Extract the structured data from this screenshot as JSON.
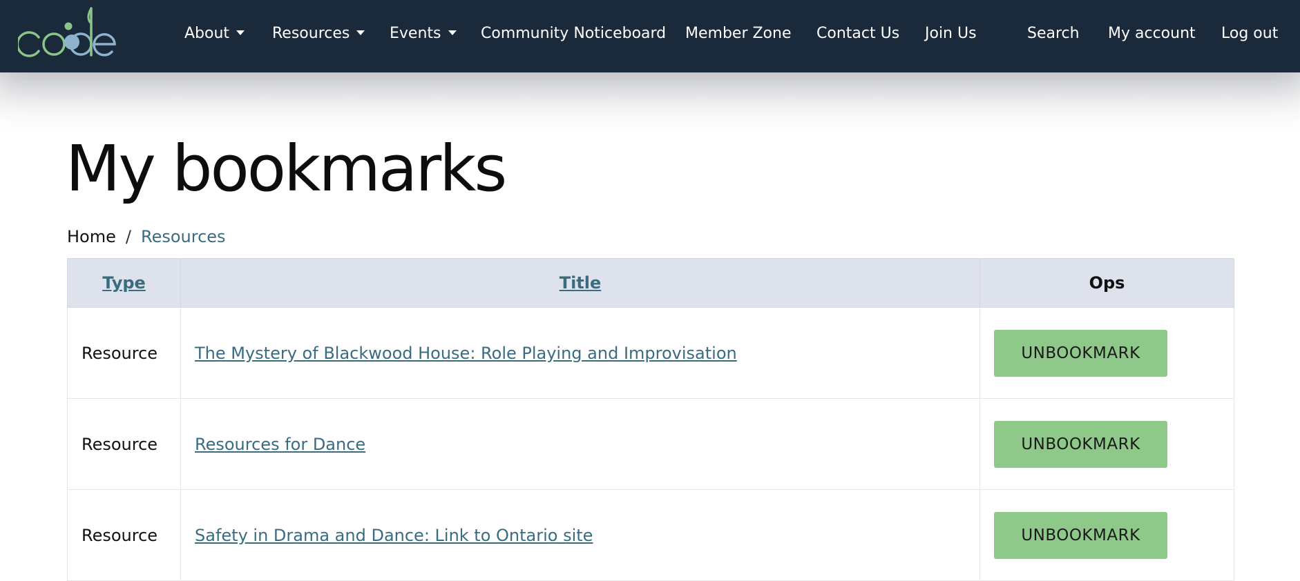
{
  "header": {
    "logo_text": "code",
    "nav": [
      {
        "label": "About",
        "dropdown": true
      },
      {
        "label": "Resources",
        "dropdown": true
      },
      {
        "label": "Events",
        "dropdown": true
      },
      {
        "label": "Community Noticeboard",
        "dropdown": false
      },
      {
        "label": "Member Zone",
        "dropdown": false
      },
      {
        "label": "Contact Us",
        "dropdown": false
      },
      {
        "label": "Join Us",
        "dropdown": false
      }
    ],
    "user_nav": [
      {
        "label": "Search"
      },
      {
        "label": "My account"
      },
      {
        "label": "Log out"
      }
    ]
  },
  "page": {
    "title": "My bookmarks",
    "breadcrumb": {
      "home": "Home",
      "separator": "/",
      "current": "Resources"
    }
  },
  "table": {
    "columns": {
      "type": "Type",
      "title": "Title",
      "ops": "Ops"
    },
    "rows": [
      {
        "type": "Resource",
        "title": "The Mystery of Blackwood House: Role Playing and Improvisation",
        "action": "UNBOOKMARK"
      },
      {
        "type": "Resource",
        "title": "Resources for Dance",
        "action": "UNBOOKMARK"
      },
      {
        "type": "Resource",
        "title": "Safety in Drama and Dance: Link to Ontario site",
        "action": "UNBOOKMARK"
      }
    ]
  },
  "colors": {
    "header_bg": "#1b2a3b",
    "logo_green": "#8cc48a",
    "logo_blue": "#8fb3cf",
    "link": "#3a6c80",
    "table_header_bg": "#dee2ec",
    "button_bg": "#8fc98a"
  }
}
